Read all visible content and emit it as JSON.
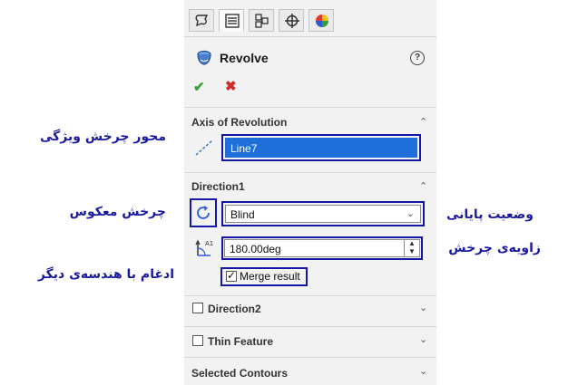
{
  "toolbar": {
    "icons": [
      "feature-manager-icon",
      "property-manager-icon",
      "configuration-manager-icon",
      "dimxpert-icon",
      "display-manager-icon"
    ],
    "active_index": 1
  },
  "header": {
    "title": "Revolve",
    "help_label": "?",
    "ok_label": "✔",
    "cancel_label": "✖"
  },
  "axis": {
    "section_title": "Axis of Revolution",
    "value": "Line7"
  },
  "direction1": {
    "section_title": "Direction1",
    "end_condition": "Blind",
    "angle": "180.00deg",
    "merge_label": "Merge result",
    "merge_checked": true
  },
  "direction2": {
    "label": "Direction2",
    "checked": false
  },
  "thin_feature": {
    "label": "Thin Feature",
    "checked": false
  },
  "selected_contours": {
    "section_title": "Selected Contours"
  },
  "annotations": {
    "axis_feature": "محور چرخش ویژگی",
    "reverse_direction": "چرخش معکوس",
    "end_condition": "وضعیت پایانی",
    "rotation_angle": "زاویه‌ی چرخش",
    "merge_geometry": "ادغام با هندسه‌ی دیگر"
  },
  "colors": {
    "highlight": "#1515a8",
    "selection_blue": "#1e6fd9",
    "annotation_text": "#1a1aa0"
  }
}
